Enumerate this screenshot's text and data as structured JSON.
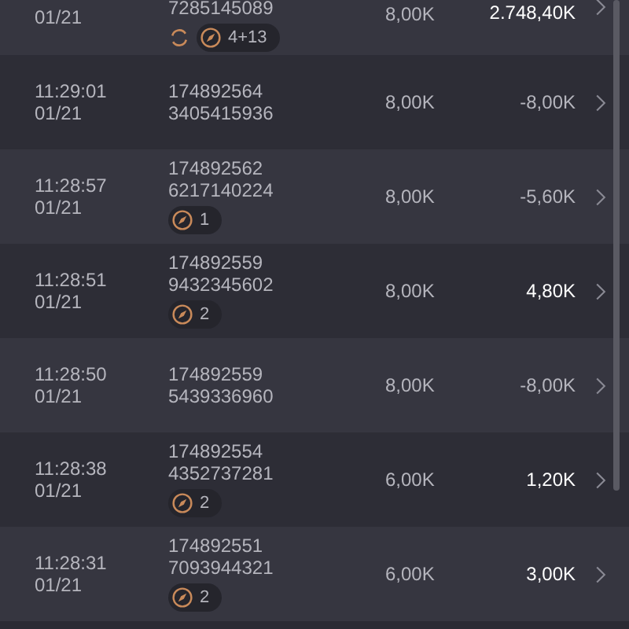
{
  "rows": [
    {
      "date": "01/21",
      "id_line_2": "7285145089",
      "amount": "8,00K",
      "result": "2.748,40K",
      "result_bright": true,
      "refresh_mark": true,
      "badge": "4+13"
    },
    {
      "time": "11:29:01",
      "date": "01/21",
      "id_line_1": "174892564",
      "id_line_2": "3405415936",
      "amount": "8,00K",
      "result": "-8,00K",
      "result_bright": false,
      "refresh_mark": false
    },
    {
      "time": "11:28:57",
      "date": "01/21",
      "id_line_1": "174892562",
      "id_line_2": "6217140224",
      "amount": "8,00K",
      "result": "-5,60K",
      "result_bright": false,
      "refresh_mark": false,
      "badge": "1"
    },
    {
      "time": "11:28:51",
      "date": "01/21",
      "id_line_1": "174892559",
      "id_line_2": "9432345602",
      "amount": "8,00K",
      "result": "4,80K",
      "result_bright": true,
      "refresh_mark": false,
      "badge": "2"
    },
    {
      "time": "11:28:50",
      "date": "01/21",
      "id_line_1": "174892559",
      "id_line_2": "5439336960",
      "amount": "8,00K",
      "result": "-8,00K",
      "result_bright": false,
      "refresh_mark": false
    },
    {
      "time": "11:28:38",
      "date": "01/21",
      "id_line_1": "174892554",
      "id_line_2": "4352737281",
      "amount": "6,00K",
      "result": "1,20K",
      "result_bright": true,
      "refresh_mark": false,
      "badge": "2"
    },
    {
      "time": "11:28:31",
      "date": "01/21",
      "id_line_1": "174892551",
      "id_line_2": "7093944321",
      "amount": "6,00K",
      "result": "3,00K",
      "result_bright": true,
      "refresh_mark": false,
      "badge": "2"
    }
  ]
}
